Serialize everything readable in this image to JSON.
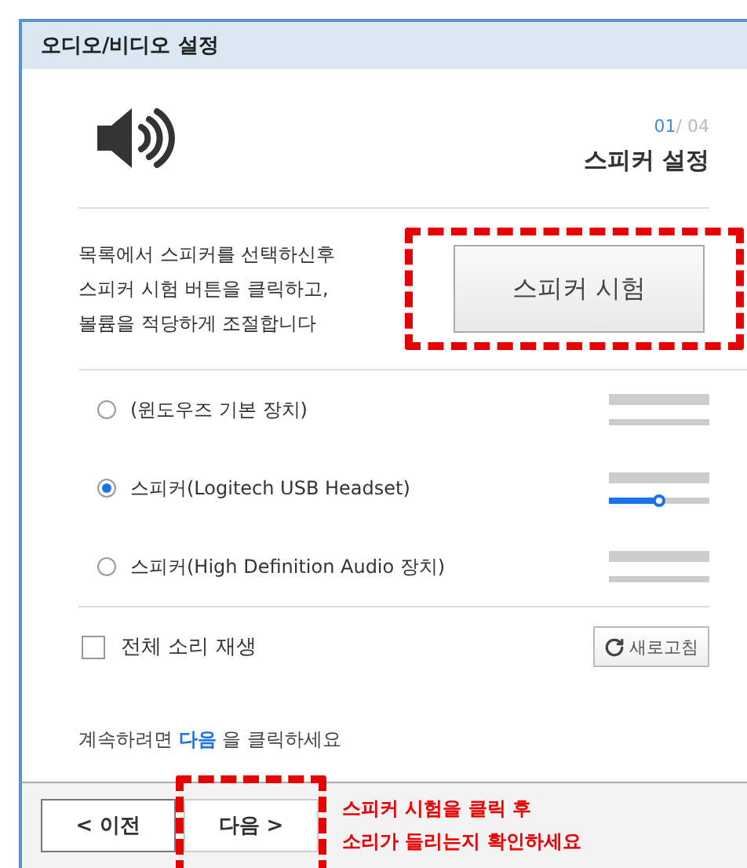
{
  "window": {
    "title": "오디오/비디오 설정"
  },
  "step": {
    "current": "01",
    "separator": "/",
    "total": "04",
    "title": "스피커 설정"
  },
  "instructions": [
    "목록에서 스피커를 선택하신후",
    "스피커 시험 버튼을 클릭하고,",
    "볼륨을 적당하게 조절합니다"
  ],
  "test_button": {
    "label": "스피커 시험",
    "highlighted": true
  },
  "devices": [
    {
      "name": "(윈도우즈 기본 장치)",
      "selected": false
    },
    {
      "name": "스피커(Logitech USB Headset)",
      "selected": true,
      "level": 0.5
    },
    {
      "name": "스피커(High Definition Audio 장치)",
      "selected": false
    }
  ],
  "play_all": {
    "label": "전체 소리 재생",
    "checked": false
  },
  "refresh_button": {
    "label": "새로고침"
  },
  "continue_hint": "계속하려면 **다음** 을 클릭하세요",
  "footer": {
    "prev_button": {
      "label": "< 이전"
    },
    "next_button": {
      "label": "다음 >",
      "highlighted": true
    },
    "note": [
      "스피커 시험을 클릭 후",
      "소리가 들리는지 확인하세요"
    ]
  }
}
